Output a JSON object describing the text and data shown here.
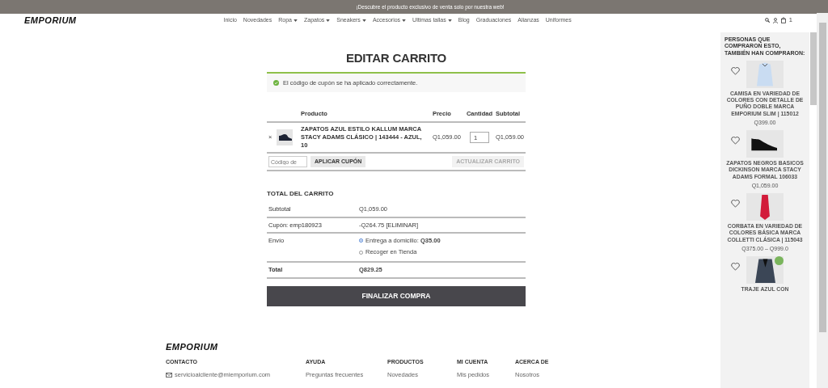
{
  "announcement": "¡Descubre el producto exclusivo de venta solo por nuestra web!",
  "logo": "EMPORIUM",
  "nav": [
    {
      "label": "Inicio",
      "dropdown": false
    },
    {
      "label": "Novedades",
      "dropdown": false
    },
    {
      "label": "Ropa",
      "dropdown": true
    },
    {
      "label": "Zapatos",
      "dropdown": true
    },
    {
      "label": "Sneakers",
      "dropdown": true
    },
    {
      "label": "Accesorios",
      "dropdown": true
    },
    {
      "label": "Ultimas tallas",
      "dropdown": true
    },
    {
      "label": "Blog",
      "dropdown": false
    },
    {
      "label": "Graduaciones",
      "dropdown": false
    },
    {
      "label": "Alianzas",
      "dropdown": false
    },
    {
      "label": "Uniformes",
      "dropdown": false
    }
  ],
  "cart_count": "1",
  "page_title": "EDITAR CARRITO",
  "notice": "El código de cupón se ha aplicado correctamente.",
  "cart_table": {
    "columns": [
      "Producto",
      "Precio",
      "Cantidad",
      "Subtotal"
    ],
    "rows": [
      {
        "remove": "×",
        "product": "ZAPATOS AZUL ESTILO KALLUM MARCA STACY ADAMS CLÁSICO | 143444 - AZUL, 10",
        "price": "Q1,059.00",
        "quantity": "1",
        "subtotal": "Q1,059.00"
      }
    ]
  },
  "coupon": {
    "placeholder": "Código de",
    "apply": "APLICAR CUPÓN",
    "update": "ACTUALIZAR CARRITO",
    "update_disabled": true
  },
  "totals": {
    "title": "TOTAL DEL CARRITO",
    "rows": [
      {
        "kind": "text",
        "label": "Subtotal",
        "value": "Q1,059.00"
      },
      {
        "kind": "coupon",
        "label": "Cupón: emp180923",
        "value": "-Q264.75",
        "action": "[ELIMINAR]"
      },
      {
        "kind": "shipping",
        "label": "Envío",
        "options": [
          {
            "label": "Entrega a domicilio: **Q35.00**",
            "selected": true
          },
          {
            "label": "Recoger en Tienda",
            "selected": false
          }
        ]
      },
      {
        "kind": "total",
        "label": "Total",
        "value": "Q829.25"
      }
    ]
  },
  "checkout": "FINALIZAR COMPRA",
  "related": {
    "title": "PERSONAS QUE COMPRARON ESTO, TAMBIÉN HAN COMPRARON:",
    "items": [
      {
        "kind": "shirt",
        "name": "CAMISA EN VARIEDAD DE COLORES CON DETALLE DE PUÑO DOBLE MARCA EMPORIUM SLIM | 115012",
        "price": "Q399.00",
        "sale": false
      },
      {
        "kind": "shoe",
        "name": "ZAPATOS NEGROS BASICOS DICKINSON MARCA STACY ADAMS FORMAL 106033",
        "price": "Q1,059.00",
        "sale": false
      },
      {
        "kind": "tie",
        "name": "CORBATA EN VARIEDAD DE COLORES BÁSICA MARCA COLLETTI CLÁSICA | 115043",
        "price": "Q375.00 – Q999.0",
        "sale": false
      },
      {
        "kind": "suit",
        "name": "TRAJE AZUL CON",
        "sale": true
      }
    ]
  },
  "footer": {
    "logo": "EMPORIUM",
    "columns": [
      {
        "title": "CONTACTO",
        "kind": "email",
        "links": [
          "servicioalcliente@miemporium.com"
        ]
      },
      {
        "title": "AYUDA",
        "kind": "links",
        "links": [
          "Preguntas frecuentes"
        ]
      },
      {
        "title": "PRODUCTOS",
        "kind": "links",
        "links": [
          "Novedades"
        ]
      },
      {
        "title": "MI CUENTA",
        "kind": "links",
        "links": [
          "Mis pedidos"
        ]
      },
      {
        "title": "ACERCA DE",
        "kind": "links",
        "links": [
          "Nosotros"
        ]
      }
    ]
  }
}
